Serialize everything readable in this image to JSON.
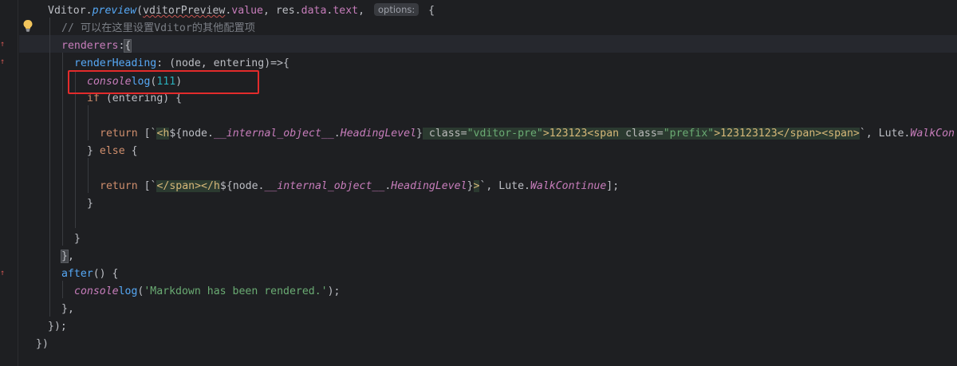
{
  "editor": {
    "lines": {
      "l1": {
        "a": "Vditor.",
        "b": "preview",
        "c": "(",
        "d": "vditorPreview",
        "e": ".",
        "f": "value",
        "g": ", res.",
        "h": "data",
        "i": ".",
        "j": "text",
        "k": ", ",
        "hint": "options:",
        "m": " {"
      },
      "l2": {
        "a": "// 可以在这里设置",
        "b": "Vditor",
        "c": "的其他配置项"
      },
      "l3": {
        "a": "renderers",
        ":": ":",
        "b": "{"
      },
      "l4": {
        "a": "renderHeading",
        ":": ": (node, entering)=>{"
      },
      "l5": {
        "a": "console",
        ".": ".",
        "b": "log",
        "c": "(",
        "n": "111",
        "d": ")"
      },
      "l6": {
        "a": "if",
        "b": " (entering) {"
      },
      "l8": {
        "ret": "return",
        "o": " [`",
        "t1": "<h",
        "d1": "${node.",
        "p1": "__internal_object__",
        "d2": ".",
        "p2": "HeadingLevel",
        "d3": "}",
        "t2": " class=",
        "s1": "\"vditor-pre\"",
        "t3": ">123123",
        "t4": "<span",
        "t5": " class=",
        "s2": "\"prefix\"",
        "t6": ">123123123",
        "t7": "</span>",
        "t8": "<span>",
        "e1": "`, Lute.",
        "w": "WalkCon"
      },
      "l9": {
        "a": "} ",
        "b": "else",
        "c": " {"
      },
      "l11": {
        "ret": "return",
        "o": " [`",
        "t1": "</span></h",
        "d1": "${node.",
        "p1": "__internal_object__",
        "d2": ".",
        "p2": "HeadingLevel",
        "d3": "}",
        "t2": ">",
        "e1": "`, Lute.",
        "w": "WalkContinue",
        "e2": "];"
      },
      "l12": {
        "a": "}"
      },
      "l14": {
        "a": "}"
      },
      "l15": {
        "a": "}",
        "b": ","
      },
      "l16": {
        "a": "after",
        "b": "() {"
      },
      "l17": {
        "a": "console",
        ".": ".",
        "b": "log",
        "c": "(",
        "s": "'Markdown has been rendered.'",
        "d": ");"
      },
      "l18": {
        "a": "},"
      },
      "l19": {
        "a": "});"
      },
      "l20": {
        "a": "})"
      }
    }
  },
  "colors": {
    "background": "#1e1f22",
    "annotation_box": "#e32b2b"
  },
  "icons": {
    "bulb": "lightbulb-icon",
    "change_marker": "arrow-up-icon"
  }
}
